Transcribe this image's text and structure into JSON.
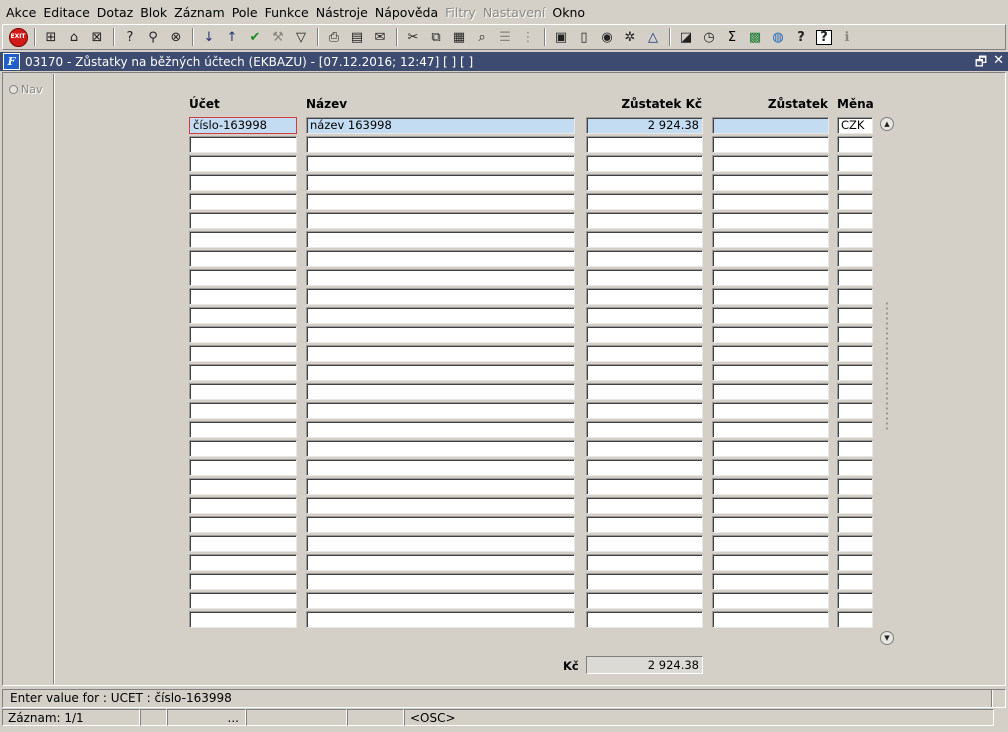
{
  "menu": [
    {
      "label": "Akce",
      "disabled": false
    },
    {
      "label": "Editace",
      "disabled": false
    },
    {
      "label": "Dotaz",
      "disabled": false
    },
    {
      "label": "Blok",
      "disabled": false
    },
    {
      "label": "Záznam",
      "disabled": false
    },
    {
      "label": "Pole",
      "disabled": false
    },
    {
      "label": "Funkce",
      "disabled": false
    },
    {
      "label": "Nástroje",
      "disabled": false
    },
    {
      "label": "Nápověda",
      "disabled": false
    },
    {
      "label": "Filtry",
      "disabled": true
    },
    {
      "label": "Nastavení",
      "disabled": true
    },
    {
      "label": "Okno",
      "disabled": false
    }
  ],
  "toolbar": {
    "exit_label": "EXIT",
    "icons": [
      "insert-record-icon",
      "save-icon",
      "delete-record-icon",
      "sep",
      "query-icon",
      "execute-query-icon",
      "cancel-query-icon",
      "sep",
      "sort-ascending-icon",
      "sort-descending-icon",
      "commit-check-icon",
      "tools-icon",
      "filter-icon",
      "sep",
      "print-icon",
      "print-preview-icon",
      "mail-icon",
      "sep",
      "cut-icon",
      "copy-icon",
      "paste-icon",
      "find-icon",
      "list-icon",
      "tree-icon",
      "sep",
      "clipboard-icon",
      "document-icon",
      "globe-icon",
      "settings-icon",
      "warning-icon",
      "sep",
      "chart-icon",
      "clock-icon",
      "sum-icon",
      "excel-icon",
      "web-icon",
      "help-question-icon",
      "context-help-icon",
      "info-icon"
    ]
  },
  "window": {
    "title": "03170 - Zůstatky na běžných účtech (EKBAZU) - [07.12.2016; 12:47]  [ ] [ ]",
    "restore_glyph": "🗗",
    "close_glyph": "✕"
  },
  "nav": {
    "label": "Nav"
  },
  "table": {
    "headers": {
      "ucet": "Účet",
      "nazev": "Název",
      "zustatek_kc": "Zůstatek Kč",
      "zustatek": "Zůstatek",
      "mena": "Měna"
    },
    "rows": [
      {
        "ucet": "číslo-163998",
        "nazev": "název 163998",
        "zustatek_kc": "2 924.38",
        "zustatek": "",
        "mena": "CZK"
      }
    ],
    "visible_rows": 27
  },
  "total": {
    "label": "Kč",
    "value": "2 924.38"
  },
  "status": {
    "message": "Enter value for : UCET : číslo-163998",
    "record": "Záznam: 1/1",
    "ellipsis": "...",
    "osc": "<OSC>"
  }
}
